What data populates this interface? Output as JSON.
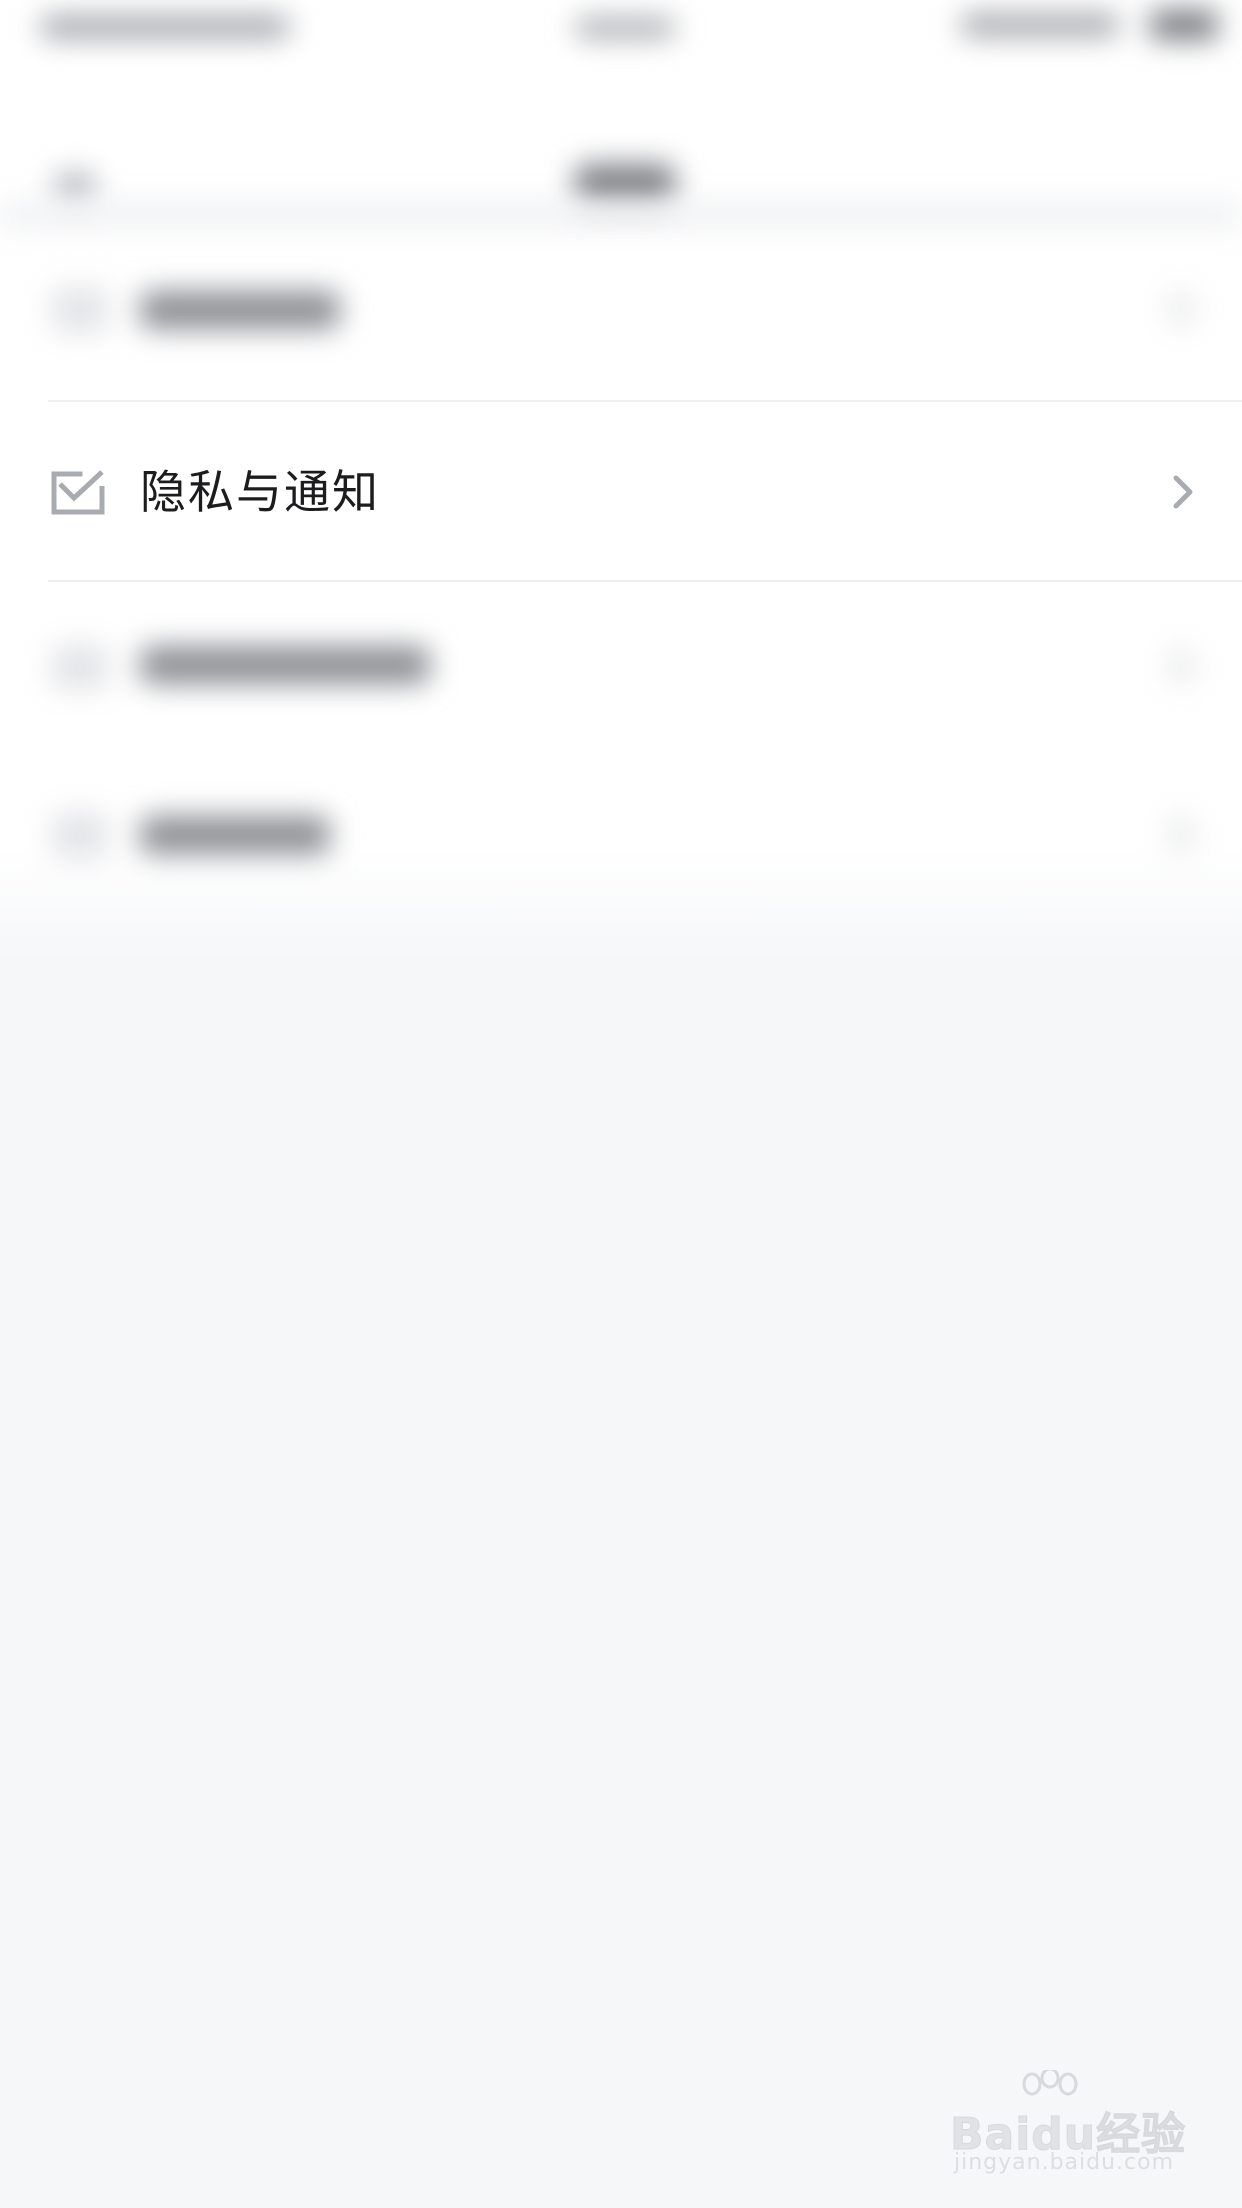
{
  "menu": {
    "active_item": {
      "label": "隐私与通知",
      "icon": "mail-icon",
      "chevron": "chevron-right-icon"
    }
  },
  "watermark": {
    "brand": "Baidu经验",
    "url": "jingyan.baidu.com"
  },
  "colors": {
    "background": "#f6f7f9",
    "surface": "#ffffff",
    "text": "#1c1c1e",
    "icon": "#a8abb0",
    "divider": "#eeeff1"
  }
}
